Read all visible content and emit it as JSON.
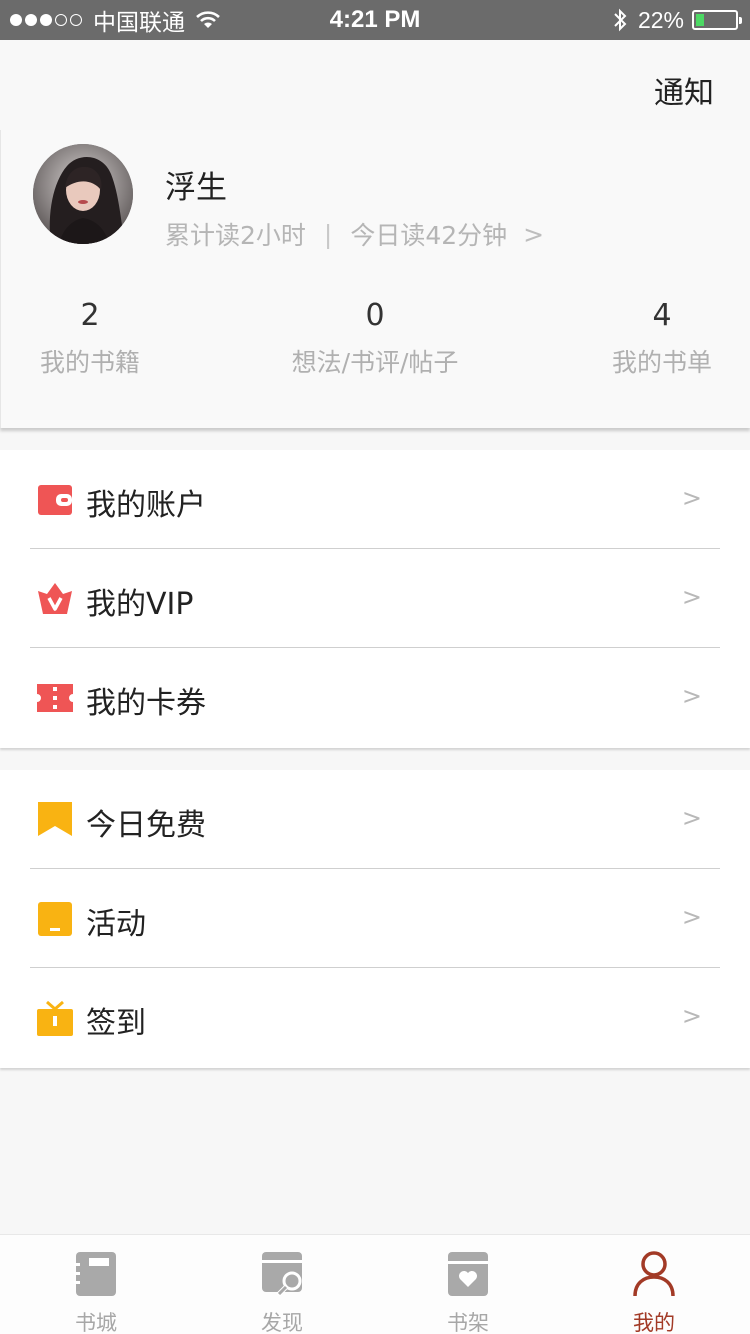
{
  "status_bar": {
    "carrier": "中国联通",
    "time": "4:21 PM",
    "battery": "22%",
    "battery_level": 0.22
  },
  "header": {
    "notify_label": "通知"
  },
  "profile": {
    "name": "浮生",
    "total_read": "累计读2小时",
    "separator": "|",
    "today_read": "今日读42分钟",
    "chevron": ">",
    "stats": [
      {
        "value": "2",
        "label": "我的书籍"
      },
      {
        "value": "0",
        "label": "想法/书评/帖子"
      },
      {
        "value": "4",
        "label": "我的书单"
      }
    ]
  },
  "menu_group1": [
    {
      "label": "我的账户",
      "icon": "wallet-icon",
      "arrow": ">"
    },
    {
      "label": "我的VIP",
      "icon": "crown-icon",
      "arrow": ">"
    },
    {
      "label": "我的卡券",
      "icon": "ticket-icon",
      "arrow": ">"
    }
  ],
  "menu_group2": [
    {
      "label": "今日免费",
      "icon": "bookmark-icon",
      "arrow": ">"
    },
    {
      "label": "活动",
      "icon": "activity-icon",
      "arrow": ">"
    },
    {
      "label": "签到",
      "icon": "gift-icon",
      "arrow": ">"
    }
  ],
  "tabbar": {
    "tabs": [
      {
        "label": "书城",
        "icon": "notebook-icon"
      },
      {
        "label": "发现",
        "icon": "discover-icon"
      },
      {
        "label": "书架",
        "icon": "bookshelf-icon"
      },
      {
        "label": "我的",
        "icon": "user-icon"
      }
    ],
    "active_index": 3
  },
  "colors": {
    "accent_red": "#ef5555",
    "accent_yellow": "#f9b312",
    "active_tab": "#a23a26",
    "status_bar": "#6b6b6b"
  }
}
